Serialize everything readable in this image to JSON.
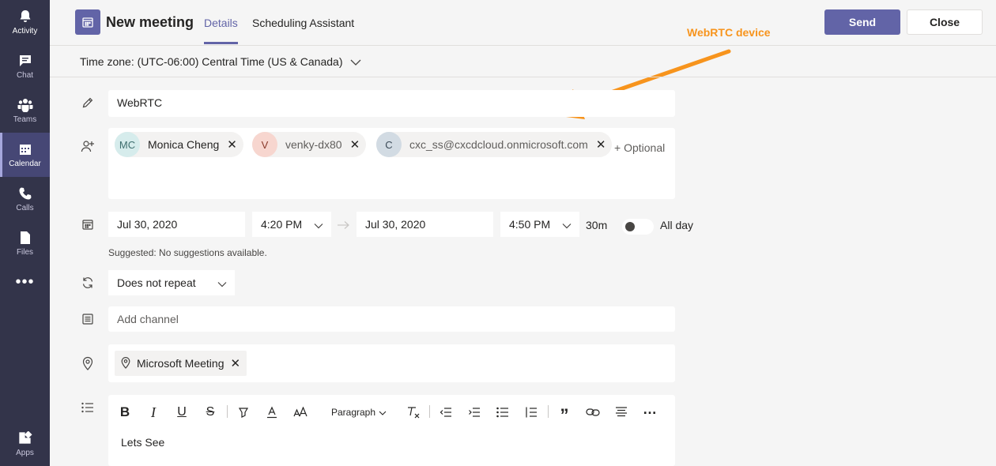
{
  "rail": {
    "items": [
      {
        "label": "Activity",
        "icon": "bell-icon"
      },
      {
        "label": "Chat",
        "icon": "chat-icon"
      },
      {
        "label": "Teams",
        "icon": "teams-icon"
      },
      {
        "label": "Calendar",
        "icon": "calendar-icon",
        "active": true
      },
      {
        "label": "Calls",
        "icon": "phone-icon"
      },
      {
        "label": "Files",
        "icon": "file-icon"
      }
    ],
    "more": "•••",
    "apps_label": "Apps"
  },
  "header": {
    "title": "New meeting",
    "tabs": [
      "Details",
      "Scheduling Assistant"
    ],
    "send_label": "Send",
    "close_label": "Close"
  },
  "annotation": "WebRTC device",
  "timezone": "Time zone: (UTC-06:00) Central Time (US & Canada)",
  "form": {
    "title_value": "WebRTC",
    "attendees": [
      {
        "initials": "MC",
        "name": "Monica Cheng",
        "avatar_bg": "#d6ecec",
        "avatar_fg": "#3f6f6f"
      },
      {
        "initials": "V",
        "name": "venky-dx80",
        "avatar_bg": "#f7d6cf",
        "avatar_fg": "#8a3a2b"
      },
      {
        "initials": "C",
        "name": "cxc_ss@cxcdcloud.onmicrosoft.com",
        "avatar_bg": "#d2dbe3",
        "avatar_fg": "#3b4a57"
      }
    ],
    "optional_label": "+ Optional",
    "start_date": "Jul 30, 2020",
    "start_time": "4:20 PM",
    "end_date": "Jul 30, 2020",
    "end_time": "4:50 PM",
    "duration": "30m",
    "all_day_label": "All day",
    "suggestion": "Suggested: No suggestions available.",
    "repeat": "Does not repeat",
    "channel_placeholder": "Add channel",
    "location": "Microsoft Meeting",
    "editor": {
      "paragraph_label": "Paragraph",
      "body_text": "Lets See"
    }
  },
  "colors": {
    "brand": "#6264a7",
    "rail": "#33344a",
    "annotation": "#f7941d"
  }
}
